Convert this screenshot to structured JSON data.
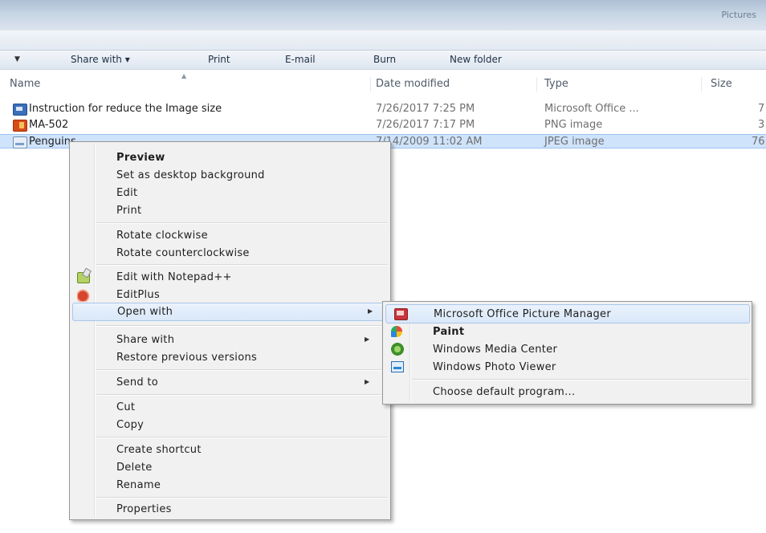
{
  "window": {
    "title": "Pictures"
  },
  "toolbar": {
    "share_with": "Share with ▾",
    "print": "Print",
    "email": "E-mail",
    "burn": "Burn",
    "new_folder": "New folder"
  },
  "columns": {
    "name": "Name",
    "date_modified": "Date modified",
    "type": "Type",
    "size": "Size"
  },
  "files": [
    {
      "name": "Instruction for reduce the Image size",
      "date": "7/26/2017 7:25 PM",
      "type": "Microsoft Office ...",
      "size": "7"
    },
    {
      "name": "MA-502",
      "date": "7/26/2017 7:17 PM",
      "type": "PNG image",
      "size": "3"
    },
    {
      "name": "Penguins",
      "date": "7/14/2009 11:02 AM",
      "type": "JPEG image",
      "size": "76"
    }
  ],
  "context_menu": {
    "preview": "Preview",
    "set_desktop_bg": "Set as desktop background",
    "edit": "Edit",
    "print": "Print",
    "rotate_cw": "Rotate clockwise",
    "rotate_ccw": "Rotate counterclockwise",
    "edit_notepadpp": "Edit with Notepad++",
    "editplus": "EditPlus",
    "open_with": "Open with",
    "share_with": "Share with",
    "restore_versions": "Restore previous versions",
    "send_to": "Send to",
    "cut": "Cut",
    "copy": "Copy",
    "create_shortcut": "Create shortcut",
    "delete": "Delete",
    "rename": "Rename",
    "properties": "Properties"
  },
  "open_with_menu": {
    "picture_manager": "Microsoft Office Picture Manager",
    "paint": "Paint",
    "media_center": "Windows Media Center",
    "photo_viewer": "Windows Photo Viewer",
    "choose_default": "Choose default program..."
  },
  "icons": {
    "submenu_arrow": "▶",
    "dropdown_arrow": "▼",
    "sort_caret": "▲"
  }
}
